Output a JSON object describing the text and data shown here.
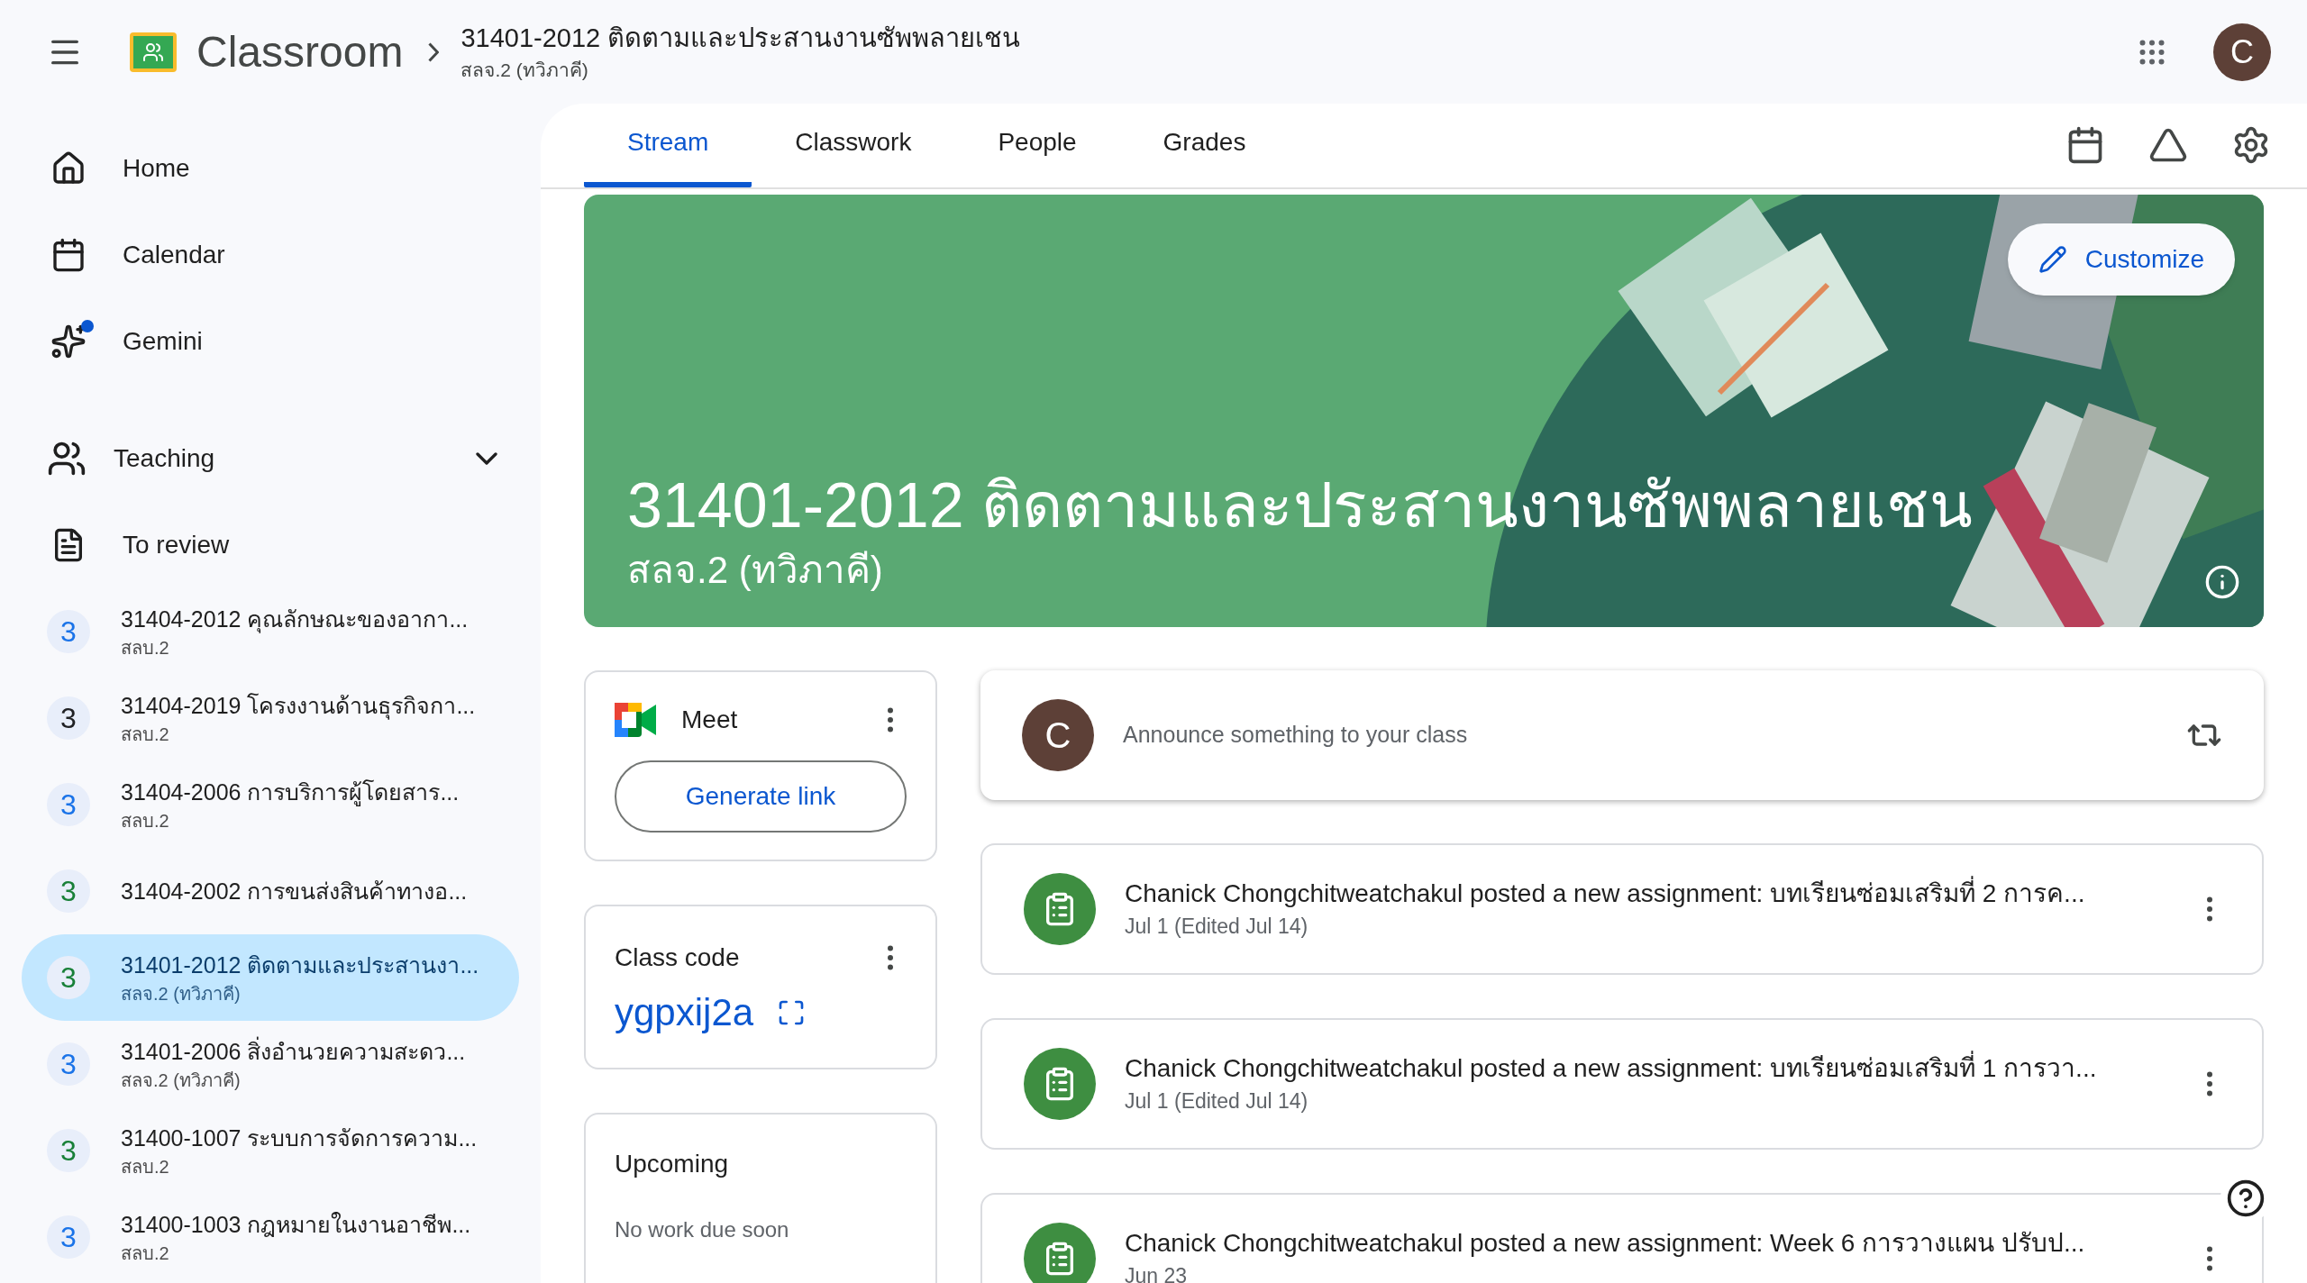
{
  "header": {
    "app_name": "Classroom",
    "course_title": "31401-2012 ติดตามและประสานงานซัพพลายเชน",
    "course_subtitle": "สลจ.2 (ทวิภาคี)",
    "avatar_letter": "C"
  },
  "sidebar": {
    "nav": [
      {
        "kind": "home",
        "label": "Home",
        "notify": false
      },
      {
        "kind": "calendar",
        "label": "Calendar",
        "notify": false
      },
      {
        "kind": "gemini",
        "label": "Gemini",
        "notify": true
      }
    ],
    "section": {
      "label": "Teaching",
      "expanded": true
    },
    "to_review": {
      "label": "To review"
    },
    "courses": [
      {
        "badge": "3",
        "color": "#1a73e8",
        "title": "31404-2012 คุณลักษณะของอากา...",
        "subtitle": "สลบ.2",
        "selected": false
      },
      {
        "badge": "3",
        "color": "#202124",
        "title": "31404-2019 โครงงานด้านธุรกิจกา...",
        "subtitle": "สลบ.2",
        "selected": false
      },
      {
        "badge": "3",
        "color": "#1a73e8",
        "title": "31404-2006 การบริการผู้โดยสาร...",
        "subtitle": "สลบ.2",
        "selected": false
      },
      {
        "badge": "3",
        "color": "#188038",
        "title": "31404-2002 การขนส่งสินค้าทางอ...",
        "selected": false
      },
      {
        "badge": "3",
        "color": "#188038",
        "title": "31401-2012 ติดตามและประสานงา...",
        "subtitle": "สลจ.2 (ทวิภาคี)",
        "selected": true
      },
      {
        "badge": "3",
        "color": "#1a73e8",
        "title": "31401-2006 สิ่งอำนวยความสะดว...",
        "subtitle": "สลจ.2 (ทวิภาคี)",
        "selected": false
      },
      {
        "badge": "3",
        "color": "#188038",
        "title": "31400-1007 ระบบการจัดการความ...",
        "subtitle": "สลบ.2",
        "selected": false
      },
      {
        "badge": "3",
        "color": "#1a73e8",
        "title": "31400-1003 กฎหมายในงานอาชีพ...",
        "subtitle": "สลบ.2",
        "selected": false
      }
    ]
  },
  "tabs": [
    {
      "label": "Stream",
      "selected": true
    },
    {
      "label": "Classwork",
      "selected": false
    },
    {
      "label": "People",
      "selected": false
    },
    {
      "label": "Grades",
      "selected": false
    }
  ],
  "banner": {
    "title": "31401-2012 ติดตามและประสานงานซัพพลายเชน",
    "subtitle": "สลจ.2 (ทวิภาคี)",
    "customize": "Customize"
  },
  "meet": {
    "title": "Meet",
    "button": "Generate link"
  },
  "class_code": {
    "title": "Class code",
    "code": "ygpxij2a"
  },
  "upcoming": {
    "title": "Upcoming",
    "message": "No work due soon"
  },
  "announce": {
    "avatar_letter": "C",
    "placeholder": "Announce something to your class"
  },
  "posts": [
    {
      "text": "Chanick Chongchitweatchakul posted a new assignment: บทเรียนซ่อมเสริมที่ 2 การค...",
      "date": "Jul 1 (Edited Jul 14)"
    },
    {
      "text": "Chanick Chongchitweatchakul posted a new assignment: บทเรียนซ่อมเสริมที่ 1 การวา...",
      "date": "Jul 1 (Edited Jul 14)"
    },
    {
      "text": "Chanick Chongchitweatchakul posted a new assignment: Week 6 การวางแผน ปรับป...",
      "date": "Jun 23"
    }
  ]
}
